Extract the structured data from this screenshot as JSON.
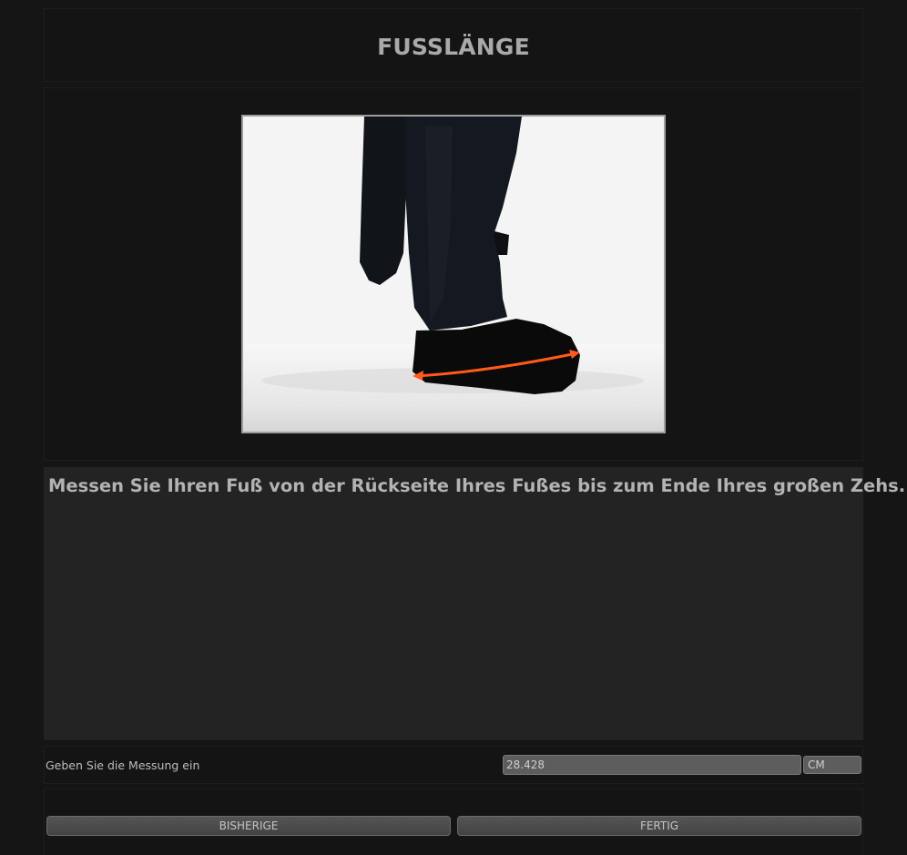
{
  "page": {
    "title": "FUSSLÄNGE"
  },
  "instruction": {
    "text": "Messen Sie Ihren Fuß von der Rückseite Ihres Fußes bis zum Ende Ihres großen Zehs."
  },
  "measurement": {
    "label": "Geben Sie die Messung ein",
    "value": "28.428",
    "unit": "CM"
  },
  "buttons": {
    "previous_label": "BISHERIGE",
    "done_label": "FERTIG"
  },
  "colors": {
    "arrow": "#ff5a1a",
    "background": "#151515",
    "panel": "#232323"
  }
}
